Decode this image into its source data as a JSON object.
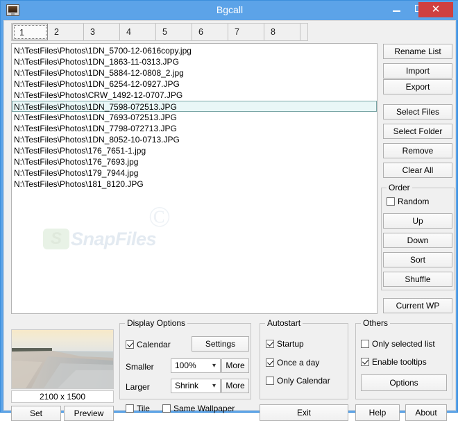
{
  "window": {
    "title": "Bgcall",
    "app_icon": "monitor-icon",
    "minimize_label": "Minimize",
    "maximize_label": "Maximize",
    "close_label": "✕",
    "accent_color": "#5CA3E8",
    "close_color": "#cf4040"
  },
  "tabs": [
    {
      "label": "1",
      "selected": true
    },
    {
      "label": "2",
      "selected": false
    },
    {
      "label": "3",
      "selected": false
    },
    {
      "label": "4",
      "selected": false
    },
    {
      "label": "5",
      "selected": false
    },
    {
      "label": "6",
      "selected": false
    },
    {
      "label": "7",
      "selected": false
    },
    {
      "label": "8",
      "selected": false
    }
  ],
  "file_list": {
    "watermark_text": "SnapFiles",
    "watermark_logo": "S",
    "watermark_copyright": "©",
    "items": [
      {
        "path": "N:\\TestFiles\\Photos\\1DN_5700-12-0616copy.jpg",
        "selected": false
      },
      {
        "path": "N:\\TestFiles\\Photos\\1DN_1863-11-0313.JPG",
        "selected": false
      },
      {
        "path": "N:\\TestFiles\\Photos\\1DN_5884-12-0808_2.jpg",
        "selected": false
      },
      {
        "path": "N:\\TestFiles\\Photos\\1DN_6254-12-0927.JPG",
        "selected": false
      },
      {
        "path": "N:\\TestFiles\\Photos\\CRW_1492-12-0707.JPG",
        "selected": false
      },
      {
        "path": "N:\\TestFiles\\Photos\\1DN_7598-072513.JPG",
        "selected": true
      },
      {
        "path": "N:\\TestFiles\\Photos\\1DN_7693-072513.JPG",
        "selected": false
      },
      {
        "path": "N:\\TestFiles\\Photos\\1DN_7798-072713.JPG",
        "selected": false
      },
      {
        "path": "N:\\TestFiles\\Photos\\1DN_8052-10-0713.JPG",
        "selected": false
      },
      {
        "path": "N:\\TestFiles\\Photos\\176_7651-1.jpg",
        "selected": false
      },
      {
        "path": "N:\\TestFiles\\Photos\\176_7693.jpg",
        "selected": false
      },
      {
        "path": "N:\\TestFiles\\Photos\\179_7944.jpg",
        "selected": false
      },
      {
        "path": "N:\\TestFiles\\Photos\\181_8120.JPG",
        "selected": false
      }
    ]
  },
  "right_buttons": {
    "rename_list": "Rename List",
    "import": "Import",
    "export": "Export",
    "select_files": "Select Files",
    "select_folder": "Select Folder",
    "remove": "Remove",
    "clear_all": "Clear All",
    "current_wp": "Current WP"
  },
  "order_group": {
    "title": "Order",
    "random_label": "Random",
    "random_checked": false,
    "up": "Up",
    "down": "Down",
    "sort": "Sort",
    "shuffle": "Shuffle"
  },
  "preview": {
    "dimensions": "2100 x 1500",
    "set_label": "Set",
    "preview_label": "Preview",
    "image_alt": "beach-sunset-thumbnail"
  },
  "display_options": {
    "title": "Display Options",
    "calendar_label": "Calendar",
    "calendar_checked": true,
    "settings_label": "Settings",
    "smaller_label": "Smaller",
    "smaller_value": "100%",
    "smaller_more": "More",
    "larger_label": "Larger",
    "larger_value": "Shrink",
    "larger_more": "More",
    "tile_label": "Tile",
    "tile_checked": false,
    "same_wallpaper_label": "Same Wallpaper",
    "same_wallpaper_checked": false
  },
  "autostart": {
    "title": "Autostart",
    "startup_label": "Startup",
    "startup_checked": true,
    "once_a_day_label": "Once a day",
    "once_a_day_checked": true,
    "only_calendar_label": "Only Calendar",
    "only_calendar_checked": false
  },
  "others": {
    "title": "Others",
    "only_selected_list_label": "Only selected list",
    "only_selected_list_checked": false,
    "enable_tooltips_label": "Enable tooltips",
    "enable_tooltips_checked": true,
    "options_label": "Options"
  },
  "bottom_buttons": {
    "exit": "Exit",
    "help": "Help",
    "about": "About"
  }
}
